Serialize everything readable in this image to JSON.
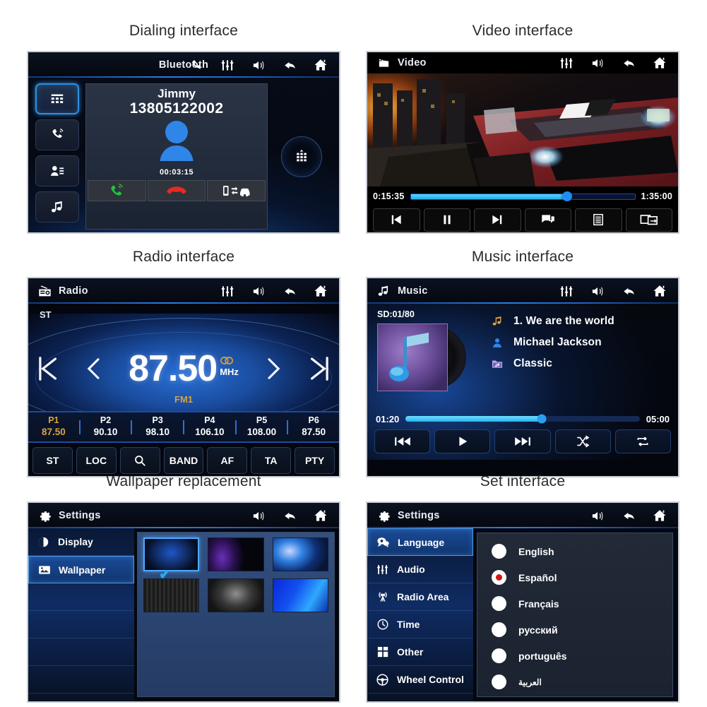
{
  "captions": {
    "dialing": "Dialing interface",
    "video": "Video interface",
    "radio": "Radio interface",
    "music": "Music interface",
    "wallpaper": "Wallpaper replacement",
    "settings": "Set interface"
  },
  "bluetooth": {
    "title": "Bluetooth",
    "title_icons": [
      "phone-call-icon",
      "equalizer-icon",
      "volume-icon",
      "back-icon",
      "home-icon"
    ],
    "side_buttons": [
      {
        "name": "keypad-button",
        "icon": "keypad-icon",
        "active": true
      },
      {
        "name": "call-log-button",
        "icon": "phone-arrow-icon",
        "active": false
      },
      {
        "name": "contacts-button",
        "icon": "contact-list-icon",
        "active": false
      },
      {
        "name": "bt-music-button",
        "icon": "music-note-icon",
        "active": false
      }
    ],
    "contact_name": "Jimmy",
    "phone_number": "13805122002",
    "call_duration": "00:03:15",
    "actions": [
      {
        "name": "answer-button",
        "icon": "green-phone-icon"
      },
      {
        "name": "hangup-button",
        "icon": "red-phone-icon"
      },
      {
        "name": "transfer-audio-button",
        "icon": "phone-to-car-icon"
      }
    ],
    "keypad_toggle": "dialpad-icon"
  },
  "video": {
    "title": "Video",
    "lead_icon": "film-clapper-icon",
    "title_icons": [
      "equalizer-icon",
      "volume-icon",
      "back-icon",
      "home-icon"
    ],
    "current_time": "0:15:35",
    "total_time": "1:35:00",
    "progress_percent": 70,
    "controls": [
      {
        "name": "previous-button",
        "icon": "prev-track-icon"
      },
      {
        "name": "pause-button",
        "icon": "pause-icon"
      },
      {
        "name": "next-button",
        "icon": "next-track-icon"
      },
      {
        "name": "subtitle-button",
        "icon": "subtitle-icon"
      },
      {
        "name": "playlist-button",
        "icon": "list-icon"
      },
      {
        "name": "screen-mirror-button",
        "icon": "screen-out-icon"
      }
    ]
  },
  "radio": {
    "title": "Radio",
    "lead_icon": "radio-icon",
    "title_icons": [
      "equalizer-icon",
      "volume-icon",
      "back-icon",
      "home-icon"
    ],
    "stereo_label": "ST",
    "frequency": "87.50",
    "unit": "MHz",
    "stereo_badge": "stereo-icon",
    "band": "FM1",
    "nav": [
      {
        "name": "seek-down-button",
        "icon": "skip-prev-icon"
      },
      {
        "name": "tune-down-button",
        "icon": "chevron-left-icon"
      },
      {
        "name": "tune-up-button",
        "icon": "chevron-right-icon"
      },
      {
        "name": "seek-up-button",
        "icon": "skip-next-icon"
      }
    ],
    "presets": [
      {
        "slot": "P1",
        "freq": "87.50",
        "selected": true
      },
      {
        "slot": "P2",
        "freq": "90.10",
        "selected": false
      },
      {
        "slot": "P3",
        "freq": "98.10",
        "selected": false
      },
      {
        "slot": "P4",
        "freq": "106.10",
        "selected": false
      },
      {
        "slot": "P5",
        "freq": "108.00",
        "selected": false
      },
      {
        "slot": "P6",
        "freq": "87.50",
        "selected": false
      }
    ],
    "buttons": [
      {
        "label": "ST",
        "name": "stereo-button"
      },
      {
        "label": "LOC",
        "name": "local-button"
      },
      {
        "label": "",
        "name": "scan-search-button",
        "icon": "search-icon"
      },
      {
        "label": "BAND",
        "name": "band-button"
      },
      {
        "label": "AF",
        "name": "af-button"
      },
      {
        "label": "TA",
        "name": "ta-button"
      },
      {
        "label": "PTY",
        "name": "pty-button"
      }
    ]
  },
  "music": {
    "title": "Music",
    "lead_icon": "music-note-icon",
    "title_icons": [
      "equalizer-icon",
      "volume-icon",
      "back-icon",
      "home-icon"
    ],
    "source_counter": "SD:01/80",
    "track_title": "1.  We are the world",
    "artist": "Michael Jackson",
    "genre": "Classic",
    "track_icon": "music-note-icon",
    "artist_icon": "person-icon",
    "genre_icon": "folder-music-icon",
    "current_time": "01:20",
    "total_time": "05:00",
    "progress_percent": 58,
    "controls": [
      {
        "name": "previous-track-button",
        "icon": "prev-track-icon"
      },
      {
        "name": "play-button",
        "icon": "play-icon"
      },
      {
        "name": "next-track-button",
        "icon": "next-track-icon"
      },
      {
        "name": "shuffle-button",
        "icon": "shuffle-icon"
      },
      {
        "name": "repeat-button",
        "icon": "repeat-icon"
      }
    ]
  },
  "wallpaper": {
    "title": "Settings",
    "lead_icon": "gear-icon",
    "title_icons": [
      "volume-icon",
      "back-icon",
      "home-icon"
    ],
    "menu": [
      {
        "label": "Display",
        "icon": "contrast-icon",
        "active": false
      },
      {
        "label": "Wallpaper",
        "icon": "image-icon",
        "active": true
      },
      {
        "label": "",
        "icon": "",
        "active": false
      },
      {
        "label": "",
        "icon": "",
        "active": false
      },
      {
        "label": "",
        "icon": "",
        "active": false
      },
      {
        "label": "",
        "icon": "",
        "active": false
      }
    ],
    "thumbs": [
      {
        "name": "wallpaper-thumb-1",
        "class": "wp1",
        "selected": true
      },
      {
        "name": "wallpaper-thumb-2",
        "class": "wp2",
        "selected": false
      },
      {
        "name": "wallpaper-thumb-3",
        "class": "wp3",
        "selected": false
      },
      {
        "name": "wallpaper-thumb-4",
        "class": "wp4",
        "selected": false
      },
      {
        "name": "wallpaper-thumb-5",
        "class": "wp5",
        "selected": false
      },
      {
        "name": "wallpaper-thumb-6",
        "class": "wp6",
        "selected": false
      }
    ],
    "check_glyph": "✔"
  },
  "settings": {
    "title": "Settings",
    "lead_icon": "gear-icon",
    "title_icons": [
      "volume-icon",
      "back-icon",
      "home-icon"
    ],
    "menu": [
      {
        "label": "Language",
        "icon": "speech-bubble-icon",
        "active": true
      },
      {
        "label": "Audio",
        "icon": "equalizer-icon",
        "active": false
      },
      {
        "label": "Radio Area",
        "icon": "antenna-icon",
        "active": false
      },
      {
        "label": "Time",
        "icon": "clock-icon",
        "active": false
      },
      {
        "label": "Other",
        "icon": "grid-blocks-icon",
        "active": false
      },
      {
        "label": "Wheel Control",
        "icon": "steering-wheel-icon",
        "active": false
      }
    ],
    "languages": [
      {
        "label": "English",
        "selected": false,
        "small": false
      },
      {
        "label": "Español",
        "selected": true,
        "small": false
      },
      {
        "label": "Français",
        "selected": false,
        "small": false
      },
      {
        "label": "русский",
        "selected": false,
        "small": false
      },
      {
        "label": "português",
        "selected": false,
        "small": false
      },
      {
        "label": "العربية",
        "selected": false,
        "small": true
      }
    ]
  },
  "colors": {
    "accent_blue": "#2b7de0",
    "amber": "#e0a33c",
    "progress_cyan": "#25b6ee",
    "selected_red": "#d71313",
    "page_bg": "#ffffff"
  }
}
